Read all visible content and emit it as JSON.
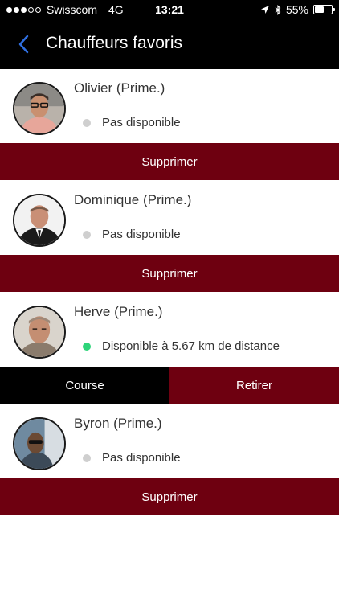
{
  "status_bar": {
    "carrier": "Swisscom",
    "network": "4G",
    "time": "13:21",
    "battery": "55%",
    "battery_level": 0.55,
    "signal_bars": 3,
    "signal_max": 5
  },
  "nav": {
    "title": "Chauffeurs favoris",
    "back_icon": "chevron-left-icon"
  },
  "colors": {
    "nav_bg": "#000000",
    "accent": "#6e0010",
    "available": "#2ed47a",
    "unavailable": "#cfcfcf"
  },
  "drivers": [
    {
      "name": "Olivier (Prime.)",
      "status": "Pas disponible",
      "available": false,
      "action": "Supprimer"
    },
    {
      "name": "Dominique (Prime.)",
      "status": "Pas disponible",
      "available": false,
      "action": "Supprimer"
    },
    {
      "name": "Herve (Prime.)",
      "status": "Disponible à 5.67 km de distance",
      "available": true,
      "actions": [
        "Course",
        "Retirer"
      ]
    },
    {
      "name": "Byron (Prime.)",
      "status": "Pas disponible",
      "available": false,
      "action": "Supprimer"
    }
  ]
}
